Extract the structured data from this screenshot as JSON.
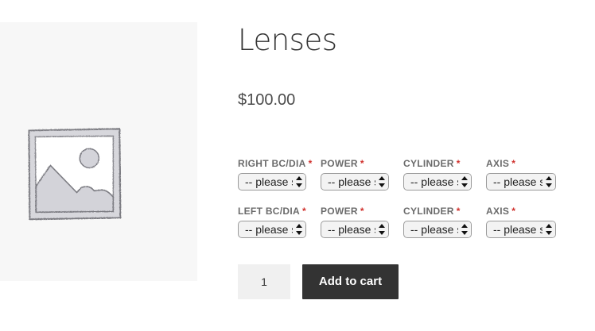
{
  "product": {
    "title": "Lenses",
    "price": "$100.00",
    "image_icon": "image-placeholder-icon"
  },
  "options": {
    "required_marker": "*",
    "right_row": [
      {
        "label": "RIGHT BC/DIA",
        "value": "-- please select --"
      },
      {
        "label": "POWER",
        "value": "-- please select --"
      },
      {
        "label": "CYLINDER",
        "value": "-- please select --"
      },
      {
        "label": "AXIS",
        "value": "-- please select --"
      }
    ],
    "left_row": [
      {
        "label": "LEFT BC/DIA",
        "value": "-- please select --"
      },
      {
        "label": "POWER",
        "value": "-- please select --"
      },
      {
        "label": "CYLINDER",
        "value": "-- please select --"
      },
      {
        "label": "AXIS",
        "value": "-- please select --"
      }
    ]
  },
  "cart": {
    "quantity": "1",
    "add_label": "Add to cart"
  },
  "colors": {
    "button_bg": "#333333",
    "required": "#d0312d"
  }
}
